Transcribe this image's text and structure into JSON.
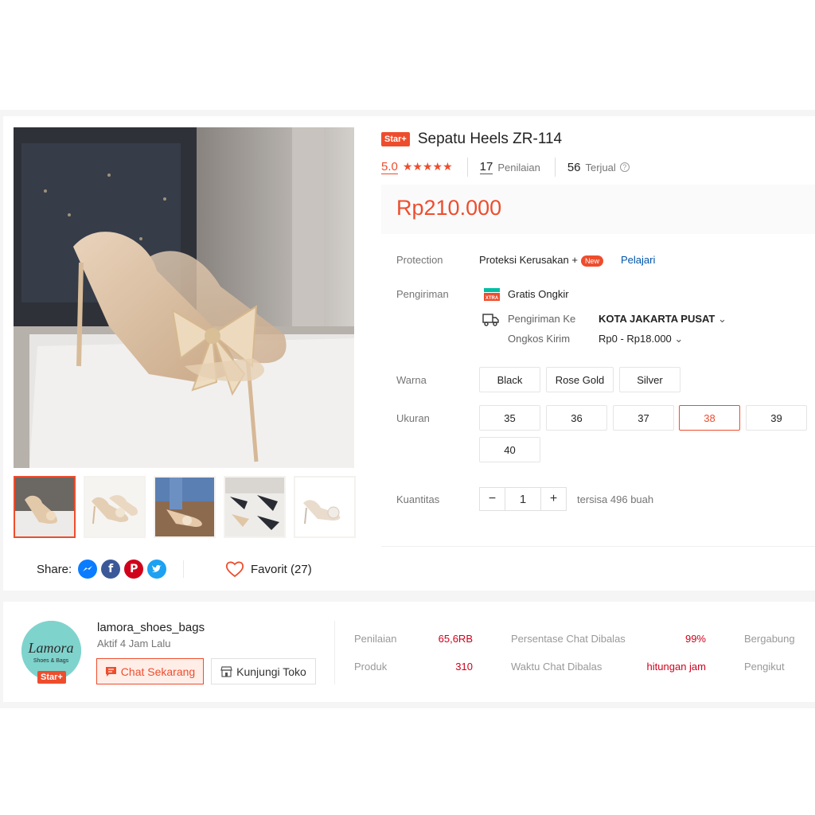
{
  "product": {
    "badge": "Star+",
    "title": "Sepatu Heels ZR-114",
    "rating": "5.0",
    "stars": "★★★★★",
    "reviews_count": "17",
    "reviews_label": "Penilaian",
    "sold_count": "56",
    "sold_label": "Terjual",
    "price": "Rp210.000"
  },
  "gallery": {
    "prev_arrow": "‹",
    "thumbnails": [
      "thumb-1",
      "thumb-2",
      "thumb-3",
      "thumb-4",
      "thumb-5"
    ],
    "active_index": 0
  },
  "protection": {
    "label": "Protection",
    "name": "Proteksi Kerusakan +",
    "new_badge": "New",
    "learn_link": "Pelajari"
  },
  "shipping": {
    "label": "Pengiriman",
    "free_shipping": "Gratis Ongkir",
    "free_icon_text": "GRATIS ONGKIR XTRA",
    "to_label": "Pengiriman Ke",
    "to_value": "KOTA JAKARTA PUSAT",
    "cost_label": "Ongkos Kirim",
    "cost_value": "Rp0 - Rp18.000"
  },
  "variants": {
    "color_label": "Warna",
    "colors": [
      "Black",
      "Rose Gold",
      "Silver"
    ],
    "size_label": "Ukuran",
    "sizes": [
      "35",
      "36",
      "37",
      "38",
      "39",
      "40"
    ],
    "selected_size": "38"
  },
  "quantity": {
    "label": "Kuantitas",
    "minus": "−",
    "value": "1",
    "plus": "+",
    "stock": "tersisa 496 buah"
  },
  "share": {
    "label": "Share:",
    "favorite": "Favorit (27)"
  },
  "shop": {
    "logo_text": "Lamora",
    "logo_sub": "Shoes & Bags",
    "badge": "Star+",
    "name": "lamora_shoes_bags",
    "active": "Aktif 4 Jam Lalu",
    "chat_button": "Chat Sekarang",
    "visit_button": "Kunjungi Toko",
    "stats": {
      "ratings_label": "Penilaian",
      "ratings_value": "65,6RB",
      "products_label": "Produk",
      "products_value": "310",
      "chat_rate_label": "Persentase Chat Dibalas",
      "chat_rate_value": "99%",
      "chat_time_label": "Waktu Chat Dibalas",
      "chat_time_value": "hitungan jam",
      "joined_label": "Bergabung",
      "followers_label": "Pengikut"
    }
  },
  "colors": {
    "accent": "#ee4d2d",
    "link": "#0055aa"
  }
}
